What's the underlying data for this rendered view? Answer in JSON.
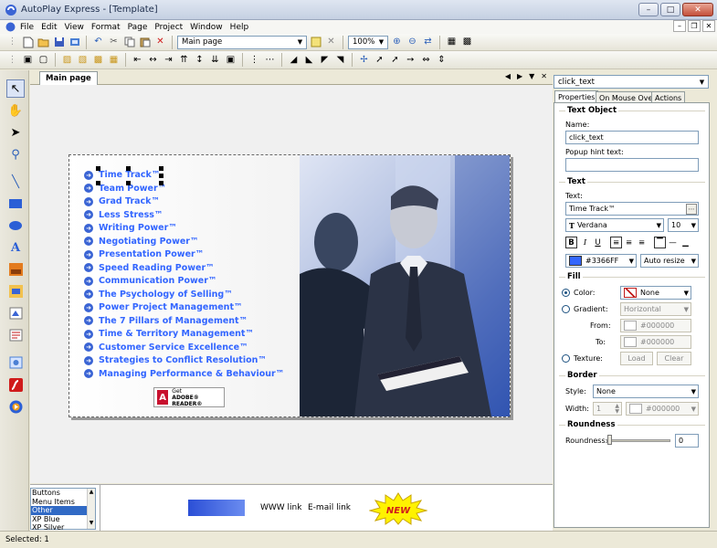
{
  "window": {
    "title": "AutoPlay Express - [Template]"
  },
  "menu": [
    "File",
    "Edit",
    "View",
    "Format",
    "Page",
    "Project",
    "Window",
    "Help"
  ],
  "toolbar": {
    "page_select": "Main page",
    "zoom": "100%"
  },
  "tabs": {
    "main_page": "Main page"
  },
  "nav": {
    "items": [
      "Time Track™",
      "Team Power™",
      "Grad Track™",
      "Less Stress™",
      "Writing Power™",
      "Negotiating Power™",
      "Presentation Power™",
      "Speed Reading Power™",
      "Communication Power™",
      "The Psychology of Selling™",
      "Power Project Management™",
      "The 7 Pillars of Management™",
      "Time & Territory Management™",
      "Customer Service Excellence™",
      "Strategies to Conflict Resolution™",
      "Managing Performance & Behaviour™"
    ],
    "color": "#3366ff"
  },
  "adobe_badge": {
    "line1": "Get",
    "line2": "ADOBE® READER®"
  },
  "style_list": {
    "items": [
      "Buttons",
      "Menu Items",
      "Other",
      "XP Blue",
      "XP Silver"
    ],
    "selected": "Other"
  },
  "preview": {
    "www_link": "WWW link",
    "email_link": "E-mail link",
    "new_label": "NEW"
  },
  "properties": {
    "object": "click_text",
    "tabs": [
      "Properties",
      "On Mouse Over",
      "Actions"
    ],
    "text_object": {
      "header": "Text Object",
      "name_label": "Name:",
      "name_value": "click_text",
      "hint_label": "Popup hint text:",
      "hint_value": ""
    },
    "text": {
      "header": "Text",
      "text_label": "Text:",
      "text_value": "Time Track™",
      "font": "Verdana",
      "size": "10",
      "color_hex": "#3366FF",
      "resize": "Auto resize"
    },
    "fill": {
      "header": "Fill",
      "color_label": "Color:",
      "color_value": "None",
      "gradient_label": "Gradient:",
      "gradient_value": "Horizontal",
      "from_label": "From:",
      "from_value": "#000000",
      "to_label": "To:",
      "to_value": "#000000",
      "texture_label": "Texture:",
      "load_label": "Load",
      "clear_label": "Clear"
    },
    "border": {
      "header": "Border",
      "style_label": "Style:",
      "style_value": "None",
      "width_label": "Width:",
      "width_value": "1",
      "color_value": "#000000"
    },
    "roundness": {
      "header": "Roundness",
      "label": "Roundness:",
      "value": "0"
    }
  },
  "status": {
    "text": "Selected: 1"
  }
}
